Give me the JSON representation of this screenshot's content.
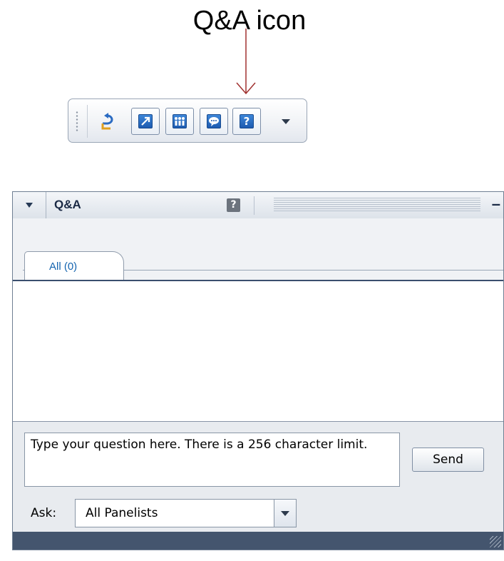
{
  "annotation": {
    "label": "Q&A icon"
  },
  "toolbar": {
    "buttons": [
      {
        "icon": "return-arrow-icon"
      },
      {
        "icon": "share-icon"
      },
      {
        "icon": "participants-icon"
      },
      {
        "icon": "chat-icon"
      },
      {
        "icon": "qa-icon",
        "glyph": "?"
      }
    ],
    "menu_icon": "chevron-down-icon"
  },
  "panel": {
    "title": "Q&A",
    "help_glyph": "?",
    "minimize_glyph": "–",
    "tabs": [
      {
        "label": "All (0)"
      }
    ],
    "question_box": {
      "text": "Type your question here. There is a 256 character limit."
    },
    "send_label": "Send",
    "ask_label": "Ask:",
    "ask_selected": "All Panelists"
  },
  "colors": {
    "accent": "#1e5bb0",
    "status_bar": "#44556e",
    "tab_text": "#1464b0"
  }
}
